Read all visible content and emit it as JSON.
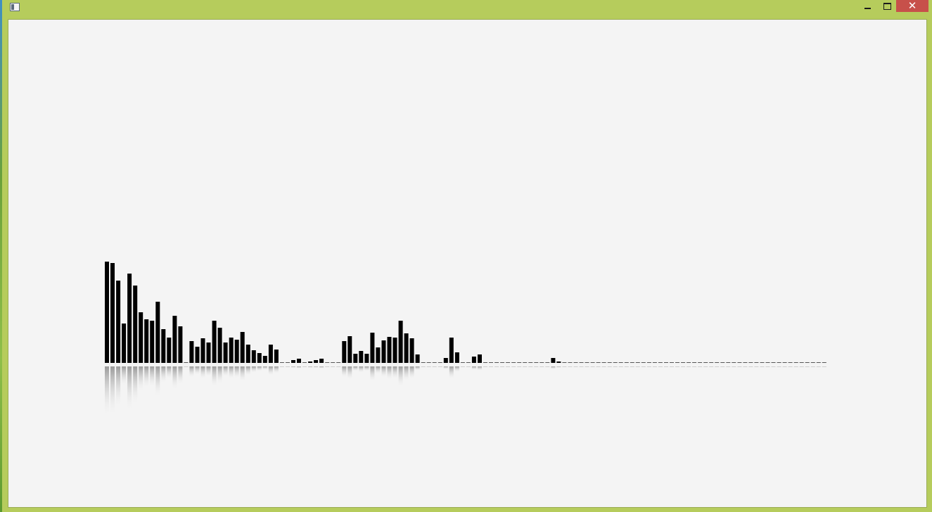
{
  "window": {
    "icon": "app-window-icon",
    "controls": {
      "minimize": "minimize-icon",
      "maximize": "maximize-icon",
      "close_label": "✕"
    },
    "colors": {
      "frame": "#b6cc5c",
      "close": "#c7504a",
      "client": "#f4f4f4"
    }
  },
  "visualizer": {
    "description_hidden": true,
    "bar_color": "#000000",
    "reflection": true,
    "levels": [
      0.15,
      0.148,
      0.122,
      0.058,
      0.132,
      0.115,
      0.075,
      0.065,
      0.062,
      0.091,
      0.05,
      0.038,
      0.07,
      0.054,
      0,
      0.032,
      0.024,
      0.036,
      0.03,
      0.063,
      0.052,
      0.03,
      0.037,
      0.034,
      0.046,
      0.027,
      0.019,
      0.015,
      0.01,
      0.027,
      0.02,
      0,
      0,
      0.004,
      0.006,
      0,
      0.002,
      0.004,
      0.006,
      0,
      0,
      0,
      0.032,
      0.04,
      0.014,
      0.018,
      0.014,
      0.045,
      0.023,
      0.033,
      0.039,
      0.038,
      0.062,
      0.044,
      0.036,
      0.013,
      0,
      0,
      0,
      0,
      0.007,
      0.037,
      0.016,
      0,
      0,
      0.009,
      0.013,
      0,
      0,
      0,
      0,
      0,
      0,
      0,
      0,
      0,
      0,
      0,
      0,
      0.007,
      0.002
    ],
    "total_bars": 128
  }
}
